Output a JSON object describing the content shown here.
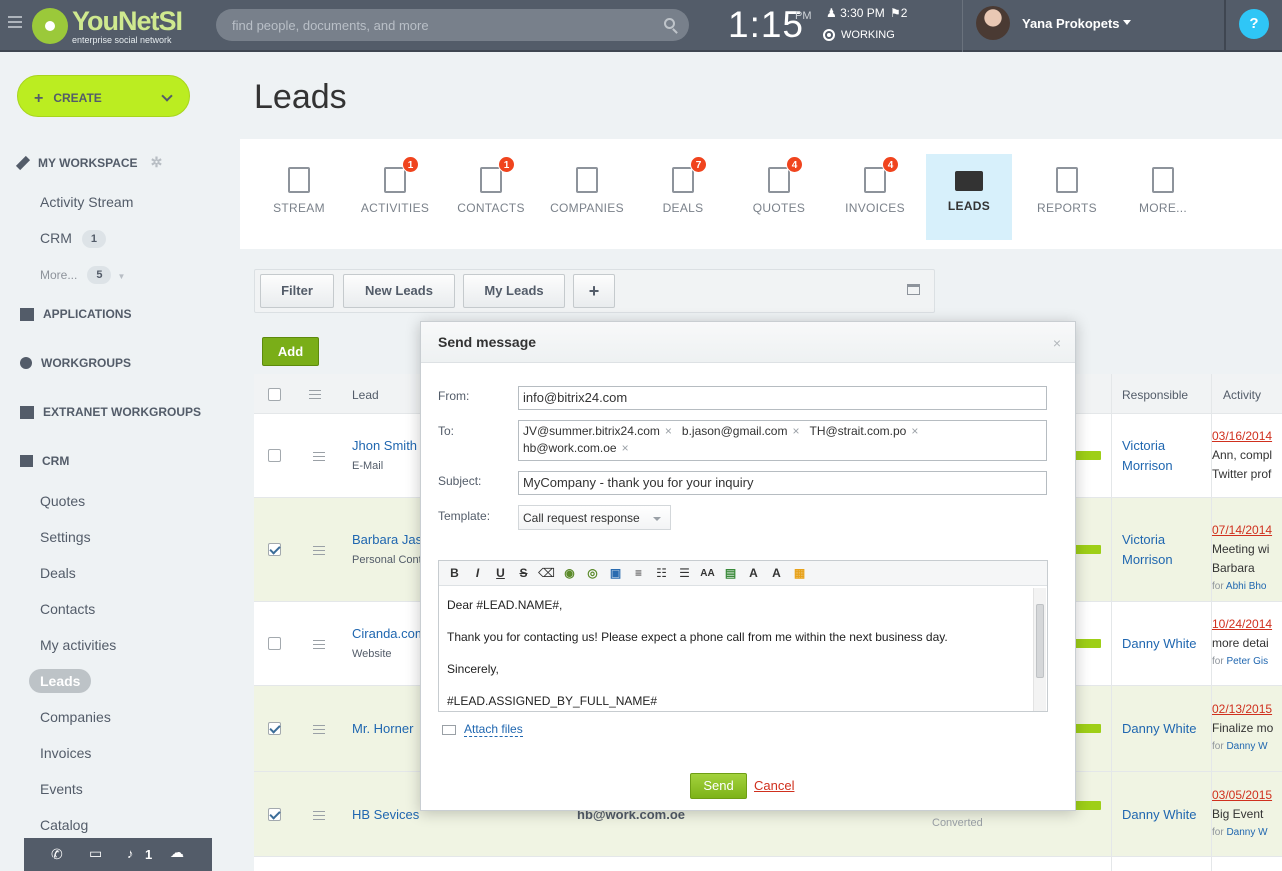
{
  "topbar": {
    "logo_name": "YouNetSI",
    "logo_sub": "enterprise social network",
    "search_placeholder": "find people, documents, and more",
    "clock": "1:15",
    "clock_ampm": "PM",
    "alarm_time": "3:30 PM",
    "flag_count": "2",
    "status": "WORKING",
    "user_name": "Yana Prokopets",
    "help": "?"
  },
  "sidebar": {
    "create": "CREATE",
    "my_workspace": "MY WORKSPACE",
    "workspace_items": [
      {
        "label": "Activity Stream"
      },
      {
        "label": "CRM",
        "count": "1"
      },
      {
        "label": "More...",
        "count": "5"
      }
    ],
    "applications": "APPLICATIONS",
    "workgroups": "WORKGROUPS",
    "extranet": "EXTRANET WORKGROUPS",
    "crm": "CRM",
    "crm_items": [
      "Quotes",
      "Settings",
      "Deals",
      "Contacts",
      "My activities",
      "Leads",
      "Companies",
      "Invoices",
      "Events",
      "Catalog"
    ],
    "notif_count": "1"
  },
  "page": {
    "title": "Leads"
  },
  "tabs": [
    {
      "label": "STREAM",
      "badge": "",
      "icon": "stream-icon"
    },
    {
      "label": "ACTIVITIES",
      "badge": "1",
      "icon": "activities-icon"
    },
    {
      "label": "CONTACTS",
      "badge": "1",
      "icon": "contacts-icon"
    },
    {
      "label": "COMPANIES",
      "badge": "",
      "icon": "companies-icon"
    },
    {
      "label": "DEALS",
      "badge": "7",
      "icon": "deals-icon"
    },
    {
      "label": "QUOTES",
      "badge": "4",
      "icon": "quotes-icon"
    },
    {
      "label": "INVOICES",
      "badge": "4",
      "icon": "invoices-icon"
    },
    {
      "label": "LEADS",
      "badge": "",
      "icon": "leads-icon",
      "active": true
    },
    {
      "label": "REPORTS",
      "badge": "",
      "icon": "reports-icon"
    },
    {
      "label": "MORE...",
      "badge": "",
      "icon": "more-icon"
    }
  ],
  "filter": {
    "filter": "Filter",
    "new_leads": "New Leads",
    "my_leads": "My Leads",
    "plus": "+"
  },
  "grid": {
    "add": "Add",
    "col_lead": "Lead",
    "col_responsible": "Responsible",
    "col_activity": "Activity",
    "rows": [
      {
        "name": "Jhon Smith",
        "sub": "E-Mail",
        "responsible": "Victoria Morrison",
        "act_date": "03/16/2014",
        "act_text": "Ann, compl",
        "act_text2": "Twitter prof",
        "act_for": "",
        "selected": false
      },
      {
        "name": "Barbara Jas",
        "sub": "Personal Cont",
        "responsible": "Victoria Morrison",
        "act_date": "07/14/2014",
        "act_text": "Meeting wi",
        "act_text2": "Barbara",
        "act_for": "Abhi Bho",
        "selected": true
      },
      {
        "name": "Ciranda.com",
        "sub": "Website",
        "responsible": "Danny White",
        "act_date": "10/24/2014",
        "act_text": "more detai",
        "act_text2": "",
        "act_for": "Peter Gis",
        "selected": false
      },
      {
        "name": "Mr. Horner",
        "sub": "",
        "responsible": "Danny White",
        "act_date": "02/13/2015",
        "act_text": "Finalize mo",
        "act_text2": "",
        "act_for": "Danny W",
        "selected": true
      },
      {
        "name": "HB Sevices",
        "sub": "",
        "email": "hb@work.com.oe",
        "status": "Converted",
        "responsible": "Danny White",
        "act_date": "03/05/2015",
        "act_text": "Big Event",
        "act_text2": "",
        "act_for": "Danny W",
        "selected": true
      }
    ],
    "for_label": "for"
  },
  "dialog": {
    "title": "Send message",
    "close": "×",
    "from_label": "From:",
    "from_value": "info@bitrix24.com",
    "to_label": "To:",
    "recipients": [
      "JV@summer.bitrix24.com",
      "b.jason@gmail.com",
      "TH@strait.com.po",
      "hb@work.com.oe"
    ],
    "subject_label": "Subject:",
    "subject_value": "MyCompany - thank you for your inquiry",
    "template_label": "Template:",
    "template_value": "Call request response",
    "body_lines": [
      "Dear #LEAD.NAME#,",
      "Thank you for contacting us!  Please expect a phone call from me within the next business day.",
      "Sincerely,",
      "#LEAD.ASSIGNED_BY_FULL_NAME#"
    ],
    "attach": "Attach files",
    "send": "Send",
    "cancel": "Cancel"
  },
  "colors": {
    "accent_green": "#bbed21",
    "badge_red": "#f0441e",
    "link_blue": "#2067b0",
    "topbar": "#535c69"
  }
}
